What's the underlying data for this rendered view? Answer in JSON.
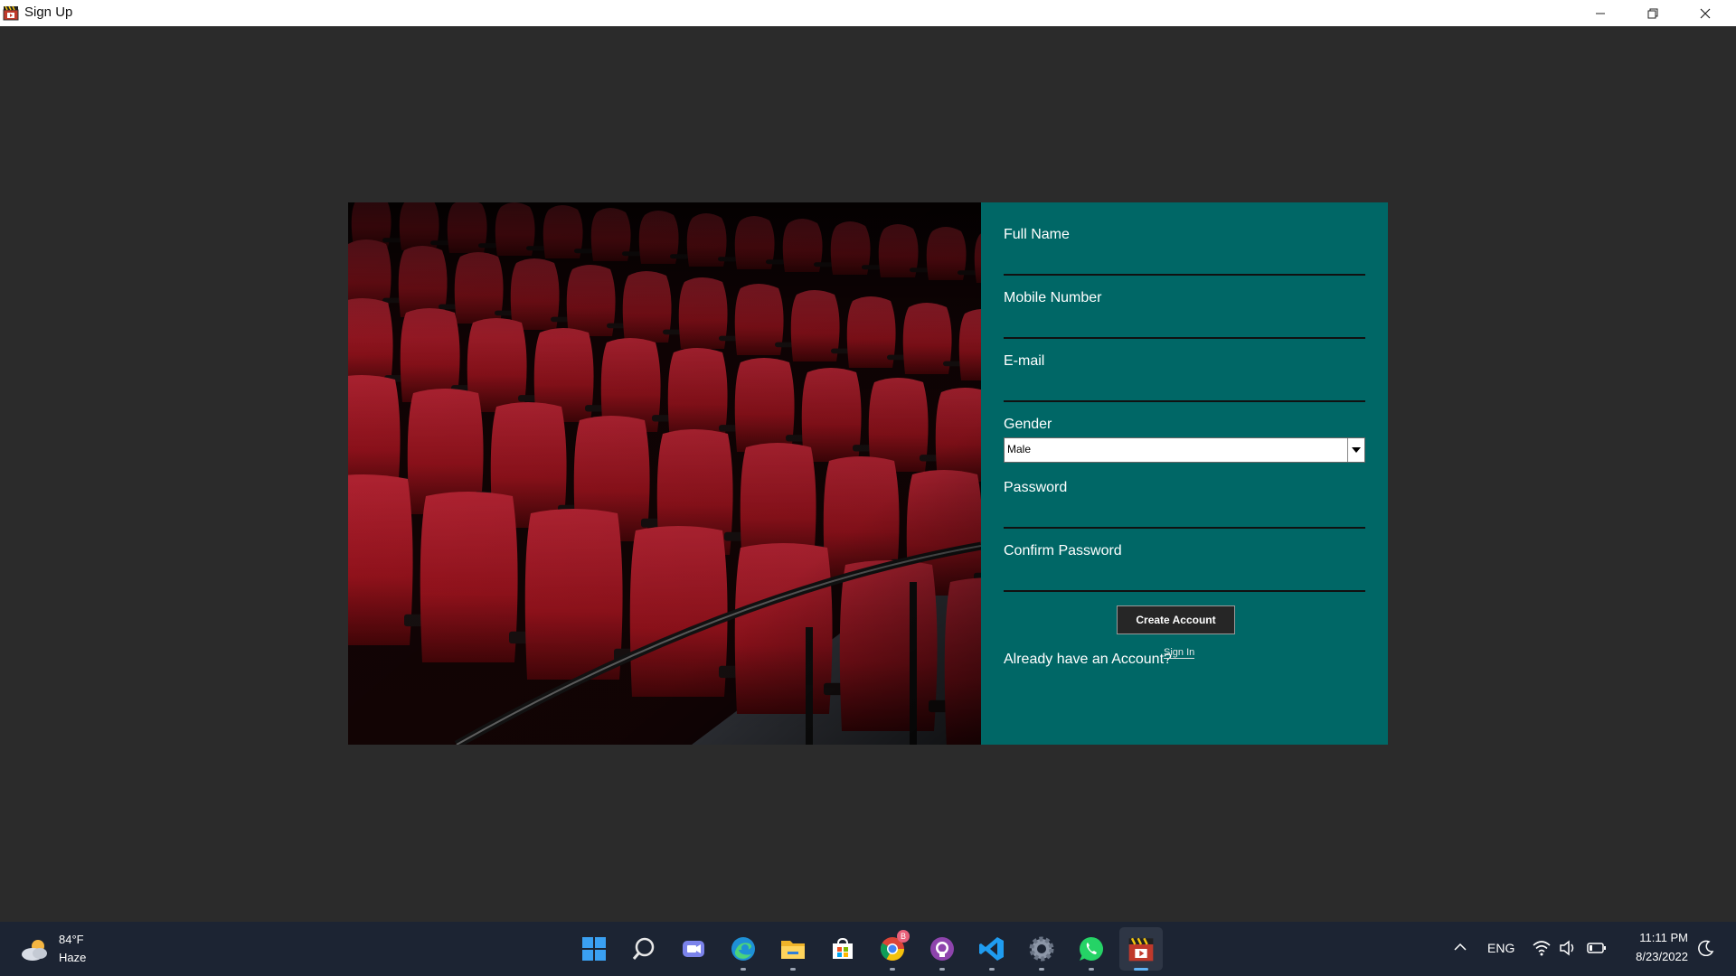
{
  "window": {
    "title": "Sign Up"
  },
  "form": {
    "full_name_label": "Full Name",
    "mobile_label": "Mobile Number",
    "email_label": "E-mail",
    "gender_label": "Gender",
    "gender_value": "Male",
    "password_label": "Password",
    "confirm_password_label": "Confirm Password",
    "create_button": "Create Account",
    "already_text": "Already have an Account?",
    "signin_link": "Sign In"
  },
  "colors": {
    "form_bg": "#006766",
    "page_bg": "#2b2b2b",
    "seat_red": "#c0192e"
  },
  "taskbar": {
    "weather_temp": "84°F",
    "weather_condition": "Haze",
    "chrome_badge": "B",
    "language": "ENG",
    "time": "11:11 PM",
    "date": "8/23/2022",
    "icons": [
      "start-icon",
      "search-icon",
      "teams-chat-icon",
      "edge-icon",
      "file-explorer-icon",
      "store-icon",
      "chrome-icon",
      "github-icon",
      "vscode-icon",
      "settings-icon",
      "whatsapp-icon",
      "movie-app-icon"
    ]
  }
}
